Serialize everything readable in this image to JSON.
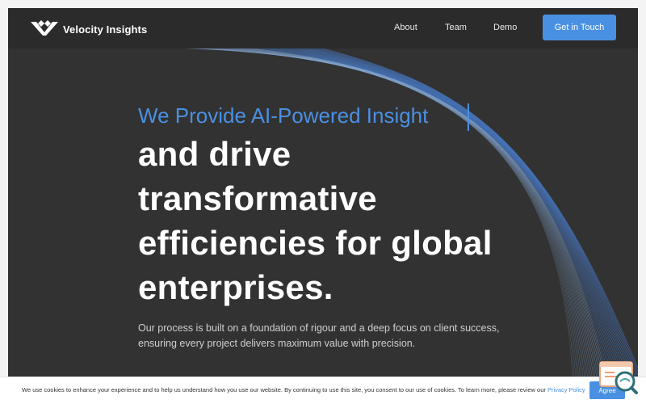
{
  "brand": {
    "name": "Velocity Insights"
  },
  "nav": {
    "links": [
      "About",
      "Team",
      "Demo"
    ],
    "cta": "Get in Touch"
  },
  "hero": {
    "accent": "We Provide AI-Powered Insight",
    "lines": [
      "and drive",
      "transformative",
      "efficiencies for global",
      "enterprises."
    ],
    "subtitle_lines": [
      "Our process is built on a foundation of rigour and a deep focus on client success,",
      "ensuring every project delivers maximum value with precision."
    ]
  },
  "cookie": {
    "text": "We use cookies to enhance your experience and to help us understand how you use our website. By continuing to use this site, you consent to our use of cookies. To learn more, please review our",
    "link": "Privacy Policy",
    "accept": "Agree"
  },
  "colors": {
    "background": "#323232",
    "navbar": "#2b2b2b",
    "accent": "#4a90e2",
    "text": "#ffffff"
  },
  "icons": {
    "logo": "velocity-logo-icon",
    "widget": "search-chat-icon"
  }
}
